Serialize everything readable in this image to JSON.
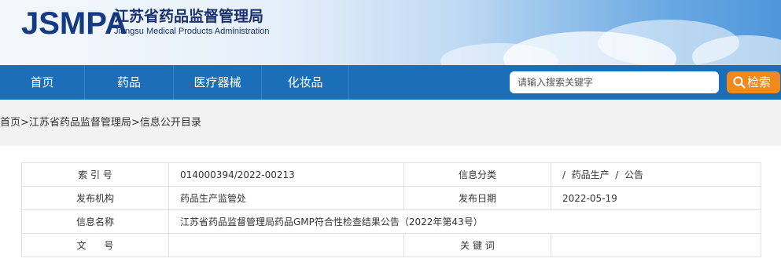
{
  "header": {
    "logo_en": "JSMPA",
    "logo_cn": "江苏省药品监督管理局",
    "logo_sub": "Jiangsu Medical Products Administration"
  },
  "nav": {
    "items": [
      "首页",
      "药品",
      "医疗器械",
      "化妆品"
    ],
    "search_placeholder": "请输入搜索关键字",
    "search_button": "检索"
  },
  "breadcrumb": {
    "items": [
      "首页",
      "江苏省药品监督管理局",
      "信息公开目录"
    ],
    "sep": ">"
  },
  "info": {
    "index_label": "索 引 号",
    "index_value": "014000394/2022-00213",
    "category_label": "信息分类",
    "category_value": "/  药品生产  /  公告",
    "org_label": "发布机构",
    "org_value": "药品生产监管处",
    "date_label": "发布日期",
    "date_value": "2022-05-19",
    "name_label": "信息名称",
    "name_value": "江苏省药品监督管理局药品GMP符合性检查结果公告（2022年第43号）",
    "docno_label": "文      号",
    "docno_value": "",
    "keyword_label": "关 键 词",
    "keyword_value": ""
  },
  "colors": {
    "nav_bg": "#1a6fb8",
    "search_btn": "#f08a1c",
    "logo": "#143a86"
  }
}
